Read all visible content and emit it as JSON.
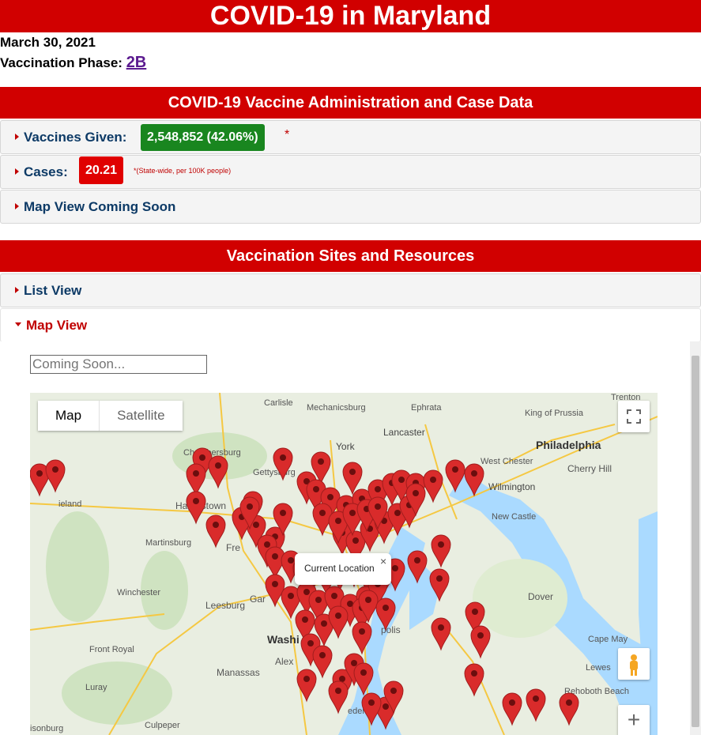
{
  "header": {
    "title": "COVID-19 in Maryland"
  },
  "date": "March 30, 2021",
  "phase": {
    "label": "Vaccination Phase:",
    "value": "2B"
  },
  "vaccine_section": {
    "title": "COVID-19 Vaccine Administration and Case Data",
    "vaccines": {
      "label": "Vaccines Given:",
      "value": "2,548,852 (42.06%)",
      "asterisk": "*"
    },
    "cases": {
      "label": "Cases:",
      "value": "20.21",
      "note": "*(State-wide, per 100K people)"
    },
    "map_view": {
      "label": "Map View Coming Soon"
    }
  },
  "sites_section": {
    "title": "Vaccination Sites and Resources",
    "list_view": {
      "label": "List View"
    },
    "map_view": {
      "label": "Map View"
    }
  },
  "search": {
    "placeholder": "Coming Soon..."
  },
  "map": {
    "type_buttons": [
      "Map",
      "Satellite"
    ],
    "popup_text": "Current Location",
    "popup_close": "×",
    "fullscreen_icon": "fullscreen-icon",
    "pegman_icon": "pegman-icon",
    "zoom_in": "+",
    "places": [
      "Trenton",
      "Carlisle",
      "Mechanicsburg",
      "Ephrata",
      "King of Prussia",
      "Lancaster",
      "York",
      "Philadelphia",
      "West Chester",
      "Cherry Hill",
      "Chambersburg",
      "Gettysburg",
      "Wilmington",
      "Hagerstown",
      "New Castle",
      "Martinsburg",
      "Fre",
      "Winchester",
      "Leesburg",
      "Gar",
      "Washi",
      "Alex",
      "Dover",
      "polis",
      "Cape May",
      "Front Royal",
      "Manassas",
      "Lewes",
      "Luray",
      "Rehoboth Beach",
      "Culpeper",
      "ederick",
      "ieland",
      "isonburg"
    ]
  },
  "colors": {
    "brand_red": "#d10000",
    "green": "#19861f",
    "badge_red": "#e00000",
    "link_purple": "#5b1a8f",
    "pin": "#d92b2b"
  }
}
